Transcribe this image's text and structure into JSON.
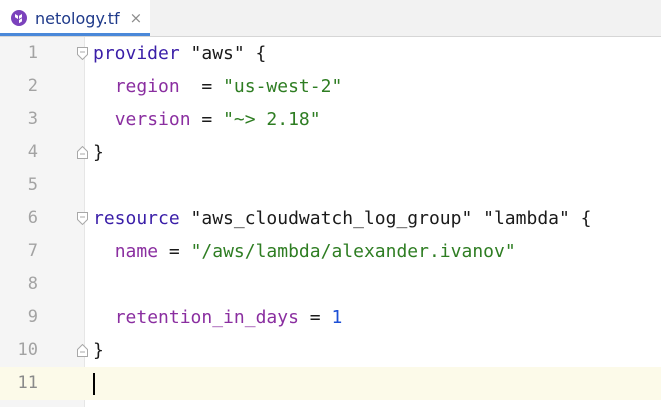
{
  "tab": {
    "label": "netology.tf",
    "close_glyph": "×",
    "icon": "terraform-icon",
    "icon_color": "#7b42bc"
  },
  "editor": {
    "current_line": 11,
    "lines": [
      {
        "num": "1",
        "tokens": [
          {
            "t": "kw",
            "v": "provider"
          },
          {
            "t": "plain",
            "v": " \"aws\" {"
          }
        ]
      },
      {
        "num": "2",
        "tokens": [
          {
            "t": "plain",
            "v": "  "
          },
          {
            "t": "prop",
            "v": "region"
          },
          {
            "t": "plain",
            "v": "  = "
          },
          {
            "t": "str",
            "v": "\"us-west-2\""
          }
        ]
      },
      {
        "num": "3",
        "tokens": [
          {
            "t": "plain",
            "v": "  "
          },
          {
            "t": "prop",
            "v": "version"
          },
          {
            "t": "plain",
            "v": " = "
          },
          {
            "t": "str",
            "v": "\"~> 2.18\""
          }
        ]
      },
      {
        "num": "4",
        "tokens": [
          {
            "t": "plain",
            "v": "}"
          }
        ]
      },
      {
        "num": "5",
        "tokens": []
      },
      {
        "num": "6",
        "tokens": [
          {
            "t": "kw",
            "v": "resource"
          },
          {
            "t": "plain",
            "v": " \"aws_cloudwatch_log_group\" \"lambda\" {"
          }
        ]
      },
      {
        "num": "7",
        "tokens": [
          {
            "t": "plain",
            "v": "  "
          },
          {
            "t": "prop",
            "v": "name"
          },
          {
            "t": "plain",
            "v": " = "
          },
          {
            "t": "str",
            "v": "\"/aws/lambda/alexander.ivanov\""
          }
        ]
      },
      {
        "num": "8",
        "tokens": []
      },
      {
        "num": "9",
        "tokens": [
          {
            "t": "plain",
            "v": "  "
          },
          {
            "t": "prop",
            "v": "retention_in_days"
          },
          {
            "t": "plain",
            "v": " = "
          },
          {
            "t": "num",
            "v": "1"
          }
        ]
      },
      {
        "num": "10",
        "tokens": [
          {
            "t": "plain",
            "v": "}"
          }
        ]
      },
      {
        "num": "11",
        "tokens": []
      }
    ],
    "fold_open_lines": [
      1,
      6
    ],
    "fold_close_lines": [
      4,
      10
    ]
  }
}
